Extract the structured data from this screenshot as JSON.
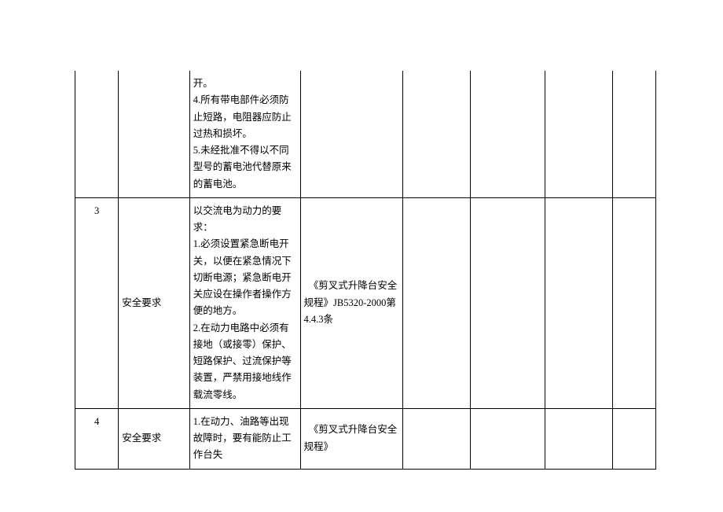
{
  "table": {
    "rows": [
      {
        "num": "",
        "category": "",
        "content": "开。\n4.所有带电部件必须防止短路，电阻器应防止过热和损坏。\n5.未经批准不得以不同型号的蓄电池代替原来的蓄电池。",
        "reference": "",
        "c5": "",
        "c6": "",
        "c7": "",
        "c8": ""
      },
      {
        "num": "3",
        "category": "安全要求",
        "content": "以交流电为动力的要求：\n1.必须设置紧急断电开关，以便在紧急情况下切断电源；紧急断电开关应设在操作者操作方便的地方。\n2.在动力电路中必须有接地（或接零）保护、短路保护、过流保护等装置，严禁用接地线作载流零线。",
        "reference": "　《剪叉式升降台安全规程》JB5320-2000第\n4.4.3条",
        "c5": "",
        "c6": "",
        "c7": "",
        "c8": ""
      },
      {
        "num": "4",
        "category": "安全要求",
        "content": "1.在动力、油路等出现故障时，要有能防止工作台失",
        "reference": "　《剪叉式升降台安全规程》",
        "c5": "",
        "c6": "",
        "c7": "",
        "c8": ""
      }
    ]
  }
}
